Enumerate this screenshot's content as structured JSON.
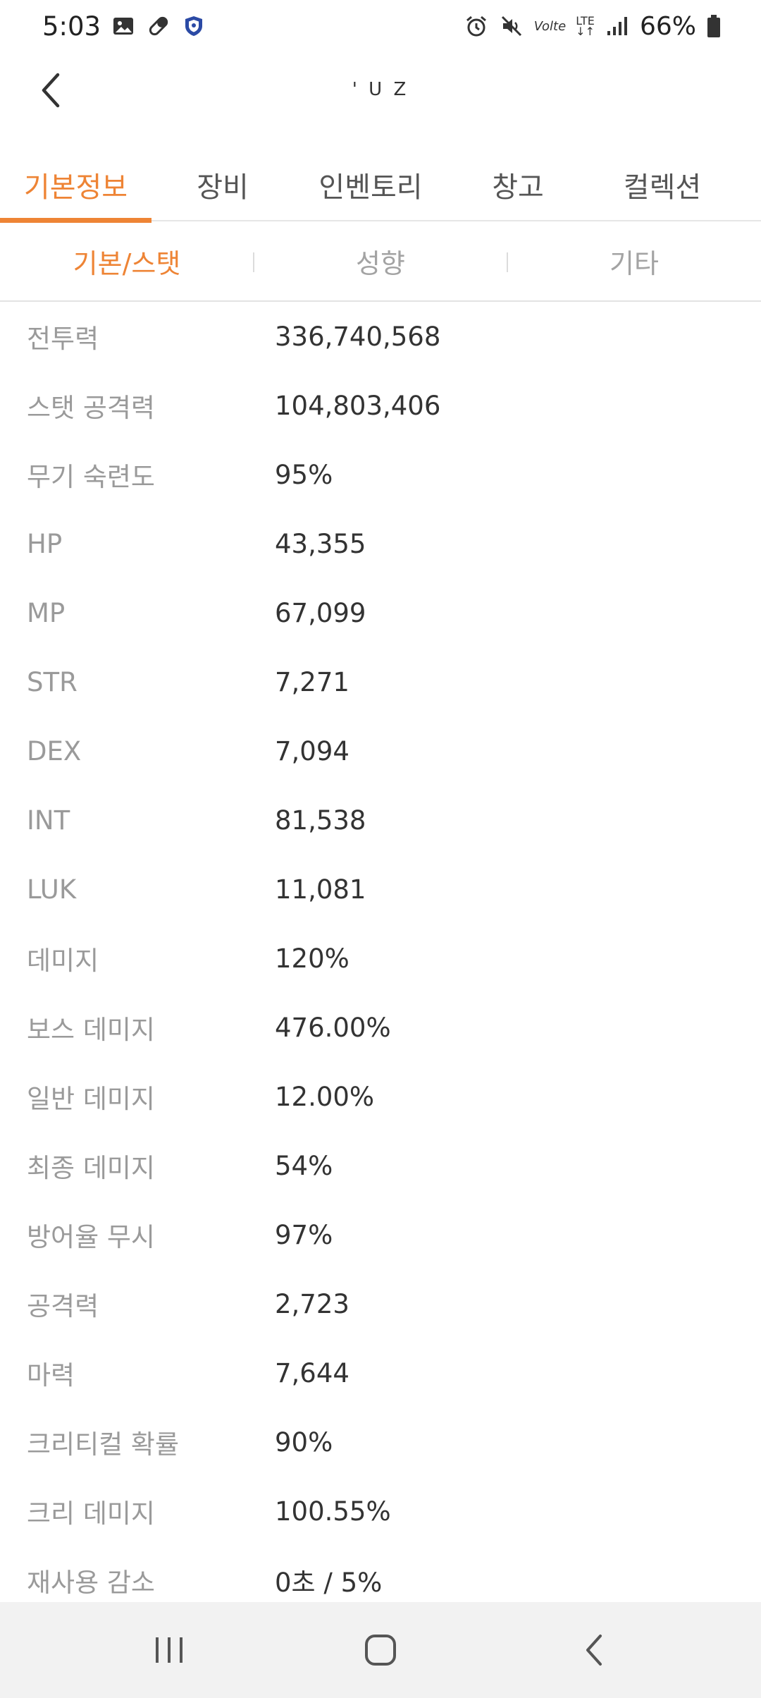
{
  "status_bar": {
    "time": "5:03",
    "volte": "Volte",
    "lte": "LTE",
    "battery": "66%",
    "icons": [
      "gallery-icon",
      "pill-icon",
      "shield-icon",
      "alarm-icon",
      "mute-icon",
      "signal-icon",
      "battery-icon"
    ]
  },
  "header": {
    "title": "' U Z"
  },
  "main_tabs": [
    {
      "label": "기본정보",
      "active": true
    },
    {
      "label": "장비",
      "active": false
    },
    {
      "label": "인벤토리",
      "active": false
    },
    {
      "label": "창고",
      "active": false
    },
    {
      "label": "컬렉션",
      "active": false
    }
  ],
  "sub_tabs": [
    {
      "label": "기본/스탯",
      "active": true
    },
    {
      "label": "성향",
      "active": false
    },
    {
      "label": "기타",
      "active": false
    }
  ],
  "stats": [
    {
      "label": "전투력",
      "value": "336,740,568"
    },
    {
      "label": "스탯 공격력",
      "value": "104,803,406"
    },
    {
      "label": "무기 숙련도",
      "value": "95%"
    },
    {
      "label": "HP",
      "value": "43,355"
    },
    {
      "label": "MP",
      "value": "67,099"
    },
    {
      "label": "STR",
      "value": "7,271"
    },
    {
      "label": "DEX",
      "value": "7,094"
    },
    {
      "label": "INT",
      "value": "81,538"
    },
    {
      "label": "LUK",
      "value": "11,081"
    },
    {
      "label": "데미지",
      "value": "120%"
    },
    {
      "label": "보스 데미지",
      "value": "476.00%"
    },
    {
      "label": "일반 데미지",
      "value": "12.00%"
    },
    {
      "label": "최종 데미지",
      "value": "54%"
    },
    {
      "label": "방어율 무시",
      "value": "97%"
    },
    {
      "label": "공격력",
      "value": "2,723"
    },
    {
      "label": "마력",
      "value": "7,644"
    },
    {
      "label": "크리티컬 확률",
      "value": "90%"
    },
    {
      "label": "크리 데미지",
      "value": "100.55%"
    },
    {
      "label": "재사용 감소",
      "value": "0초 / 5%"
    }
  ],
  "colors": {
    "accent": "#ee8435",
    "label": "#9a9a9a",
    "value": "#333333",
    "nav_bg": "#f2f2f2"
  }
}
